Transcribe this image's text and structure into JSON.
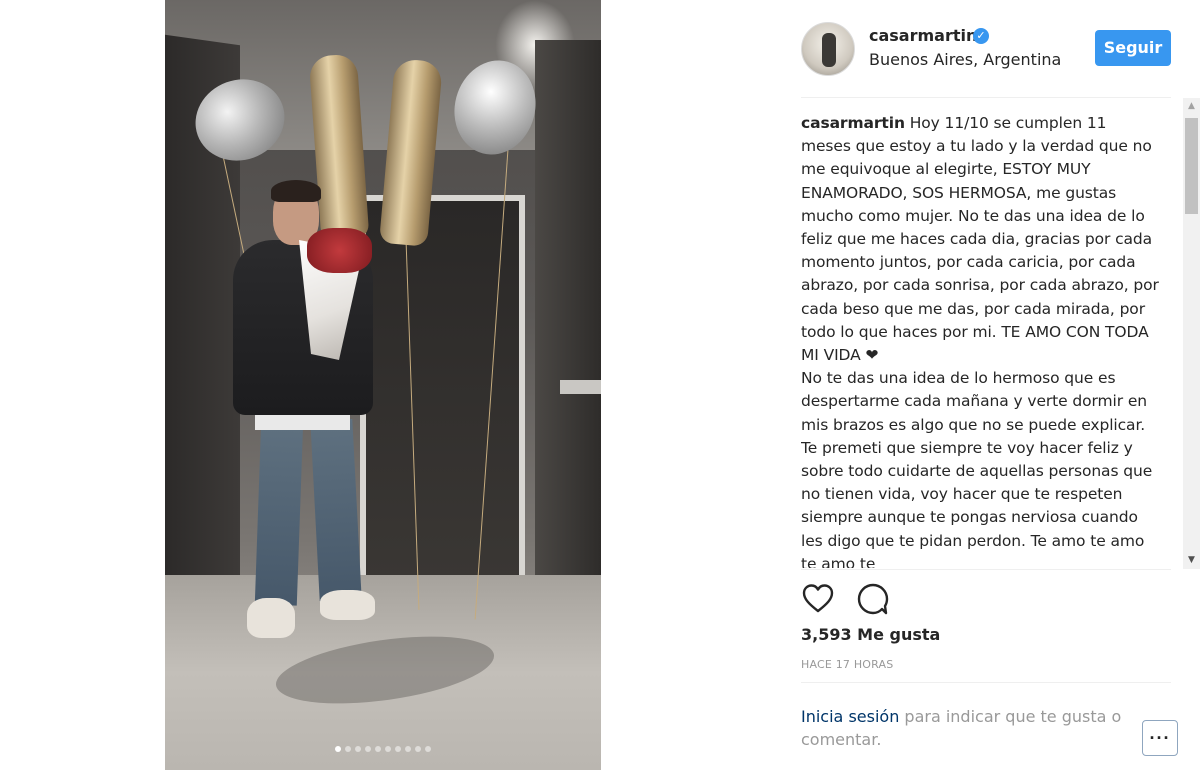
{
  "post": {
    "username": "casarmartin",
    "location": "Buenos Aires, Argentina",
    "follow_label": "Seguir",
    "caption_paragraphs": [
      "Hoy 11/10 se cumplen 11 meses que estoy a tu lado y la verdad que no me equivoque al elegirte, ESTOY MUY ENAMORADO, SOS HERMOSA, me gustas mucho como mujer. No te das una idea de lo feliz que me haces cada dia, gracias por cada momento juntos, por cada caricia, por cada abrazo, por cada sonrisa, por cada abrazo, por cada beso que me das, por cada mirada, por todo lo que haces por mi. TE AMO CON TODA MI VIDA ❤",
      "No te das una idea de lo hermoso que es despertarme cada mañana y verte dormir en mis brazos es algo que no se puede explicar. Te premeti que siempre te voy hacer feliz y sobre todo cuidarte de aquellas personas que no tienen vida, voy hacer que te respeten siempre aunque te pongas nerviosa cuando les digo que te pidan perdon. Te amo te amo te amo te"
    ],
    "likes": "3,593 Me gusta",
    "time": "HACE 17 HORAS",
    "login_link": "Inicia sesión",
    "login_rest": " para indicar que te gusta o comentar.",
    "more_label": "···"
  },
  "carousel": {
    "count": 10,
    "active_index": 0
  },
  "icons": {
    "verified": "verified-badge-icon",
    "like": "heart-icon",
    "comment": "comment-icon"
  },
  "colors": {
    "accent": "#3897f0",
    "text": "#262626",
    "muted": "#999999",
    "link": "#003569"
  }
}
